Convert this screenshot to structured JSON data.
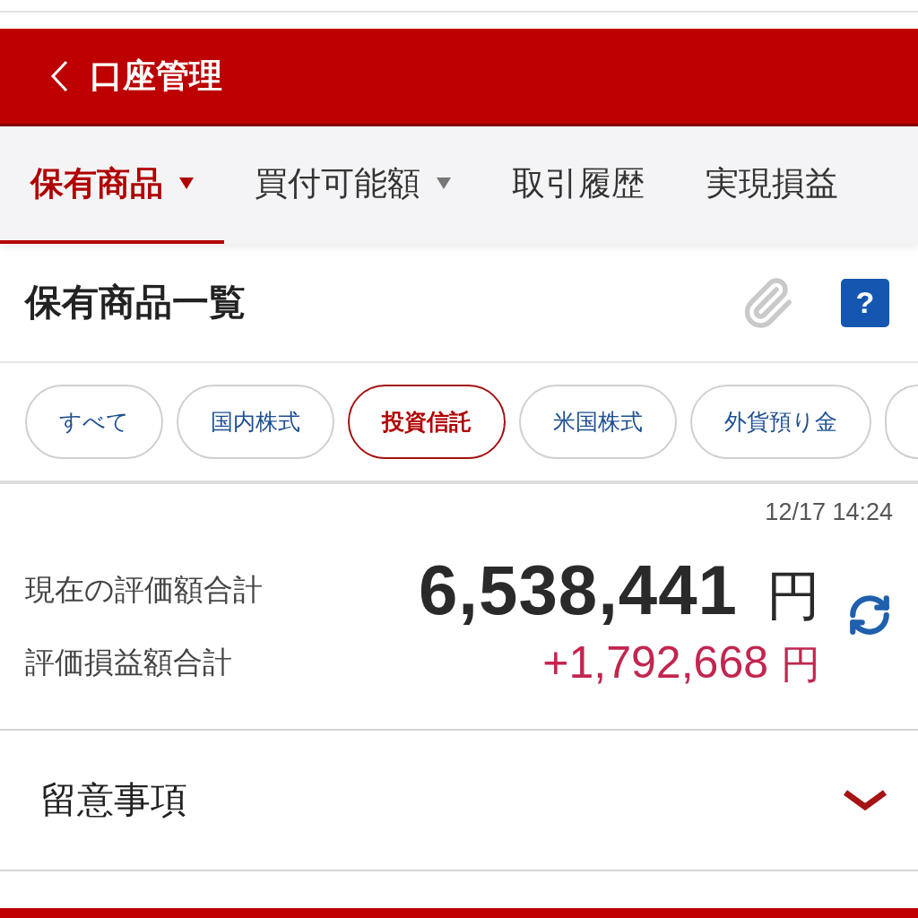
{
  "header": {
    "title": "口座管理"
  },
  "tabs": [
    {
      "label": "保有商品",
      "selected": true,
      "dropdown": true
    },
    {
      "label": "買付可能額",
      "selected": false,
      "dropdown": true
    },
    {
      "label": "取引履歴",
      "selected": false,
      "dropdown": false
    },
    {
      "label": "実現損益",
      "selected": false,
      "dropdown": false
    }
  ],
  "section": {
    "title": "保有商品一覧",
    "help": "?"
  },
  "filters": [
    {
      "label": "すべて",
      "selected": false
    },
    {
      "label": "国内株式",
      "selected": false
    },
    {
      "label": "投資信託",
      "selected": true
    },
    {
      "label": "米国株式",
      "selected": false
    },
    {
      "label": "外貨預り金",
      "selected": false
    }
  ],
  "summary": {
    "timestamp": "12/17 14:24",
    "rows": [
      {
        "kind": "total",
        "label": "現在の評価額合計",
        "value": "6,538,441",
        "unit": "円"
      },
      {
        "kind": "gain",
        "label": "評価損益額合計",
        "value": "+1,792,668",
        "unit": "円"
      }
    ]
  },
  "notes": {
    "title": "留意事項",
    "expanded": false
  }
}
